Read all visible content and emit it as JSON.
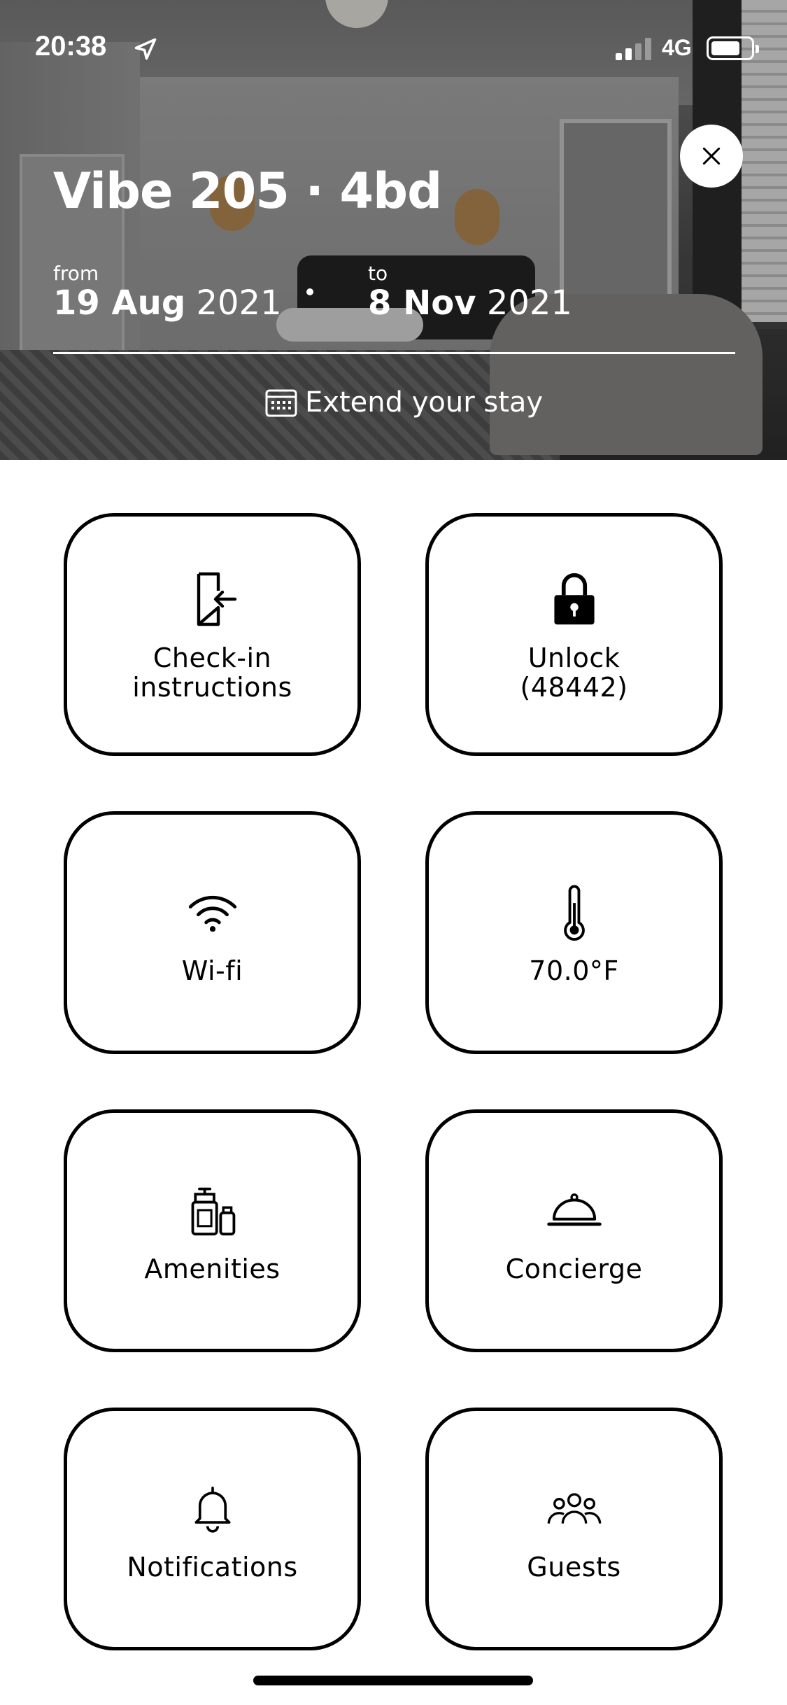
{
  "status_bar": {
    "time": "20:38",
    "network": "4G",
    "icons": [
      "location-arrow-icon",
      "signal-icon",
      "battery-icon"
    ]
  },
  "stay": {
    "title": "Vibe 205 · 4bd",
    "from_label": "from",
    "from_date": "19 Aug",
    "from_year": "2021",
    "to_label": "to",
    "to_date": "8 Nov",
    "to_year": "2021",
    "extend_label": "Extend your stay"
  },
  "tiles": [
    {
      "id": "checkin",
      "label": "Check-in",
      "label2": "instructions",
      "icon": "door-enter-icon"
    },
    {
      "id": "unlock",
      "label": "Unlock",
      "label2": "(48442)",
      "icon": "lock-icon"
    },
    {
      "id": "wifi",
      "label": "Wi-fi",
      "icon": "wifi-icon"
    },
    {
      "id": "thermostat",
      "label": "70.0°F",
      "icon": "thermometer-icon"
    },
    {
      "id": "amenities",
      "label": "Amenities",
      "icon": "toiletries-icon"
    },
    {
      "id": "concierge",
      "label": "Concierge",
      "icon": "service-bell-icon"
    },
    {
      "id": "notifications",
      "label": "Notifications",
      "icon": "bell-icon"
    },
    {
      "id": "guests",
      "label": "Guests",
      "icon": "people-icon"
    }
  ],
  "colors": {
    "tile_border": "#000000",
    "background": "#ffffff",
    "hero_text": "#ffffff"
  }
}
